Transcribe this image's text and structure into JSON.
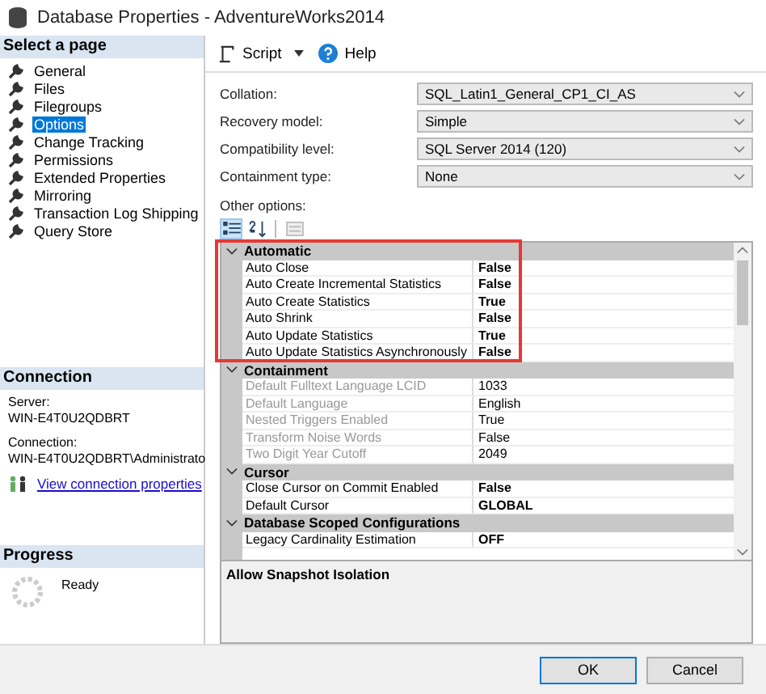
{
  "window": {
    "title": "Database Properties - AdventureWorks2014"
  },
  "sidebar": {
    "heading": "Select a page",
    "items": [
      {
        "label": "General",
        "selected": false
      },
      {
        "label": "Files",
        "selected": false
      },
      {
        "label": "Filegroups",
        "selected": false
      },
      {
        "label": "Options",
        "selected": true
      },
      {
        "label": "Change Tracking",
        "selected": false
      },
      {
        "label": "Permissions",
        "selected": false
      },
      {
        "label": "Extended Properties",
        "selected": false
      },
      {
        "label": "Mirroring",
        "selected": false
      },
      {
        "label": "Transaction Log Shipping",
        "selected": false
      },
      {
        "label": "Query Store",
        "selected": false
      }
    ]
  },
  "connection": {
    "heading": "Connection",
    "server_label": "Server:",
    "server": "WIN-E4T0U2QDBRT",
    "connection_label": "Connection:",
    "connection": "WIN-E4T0U2QDBRT\\Administrato",
    "link": "View connection properties"
  },
  "progress": {
    "heading": "Progress",
    "status": "Ready"
  },
  "toolbar": {
    "script": "Script",
    "help": "Help"
  },
  "form": [
    {
      "label": "Collation:",
      "value": "SQL_Latin1_General_CP1_CI_AS"
    },
    {
      "label": "Recovery model:",
      "value": "Simple"
    },
    {
      "label": "Compatibility level:",
      "value": "SQL Server 2014 (120)"
    },
    {
      "label": "Containment type:",
      "value": "None"
    }
  ],
  "other_options_label": "Other options:",
  "grid_toolbar": {
    "categorized_selected": true
  },
  "property_grid": [
    {
      "category": "Automatic",
      "expanded": true,
      "highlighted": true,
      "rows": [
        {
          "name": "Auto Close",
          "value": "False",
          "readonly": false
        },
        {
          "name": "Auto Create Incremental Statistics",
          "value": "False",
          "readonly": false
        },
        {
          "name": "Auto Create Statistics",
          "value": "True",
          "readonly": false
        },
        {
          "name": "Auto Shrink",
          "value": "False",
          "readonly": false
        },
        {
          "name": "Auto Update Statistics",
          "value": "True",
          "readonly": false
        },
        {
          "name": "Auto Update Statistics Asynchronously",
          "value": "False",
          "readonly": false
        }
      ]
    },
    {
      "category": "Containment",
      "expanded": true,
      "rows": [
        {
          "name": "Default Fulltext Language LCID",
          "value": "1033",
          "readonly": true
        },
        {
          "name": "Default Language",
          "value": "English",
          "readonly": true
        },
        {
          "name": "Nested Triggers Enabled",
          "value": "True",
          "readonly": true
        },
        {
          "name": "Transform Noise Words",
          "value": "False",
          "readonly": true
        },
        {
          "name": "Two Digit Year Cutoff",
          "value": "2049",
          "readonly": true
        }
      ]
    },
    {
      "category": "Cursor",
      "expanded": true,
      "rows": [
        {
          "name": "Close Cursor on Commit Enabled",
          "value": "False",
          "readonly": false
        },
        {
          "name": "Default Cursor",
          "value": "GLOBAL",
          "readonly": false
        }
      ]
    },
    {
      "category": "Database Scoped Configurations",
      "expanded": true,
      "rows": [
        {
          "name": "Legacy Cardinality Estimation",
          "value": "OFF",
          "readonly": false
        }
      ]
    }
  ],
  "description": "Allow Snapshot Isolation",
  "buttons": [
    "OK",
    "Cancel"
  ]
}
